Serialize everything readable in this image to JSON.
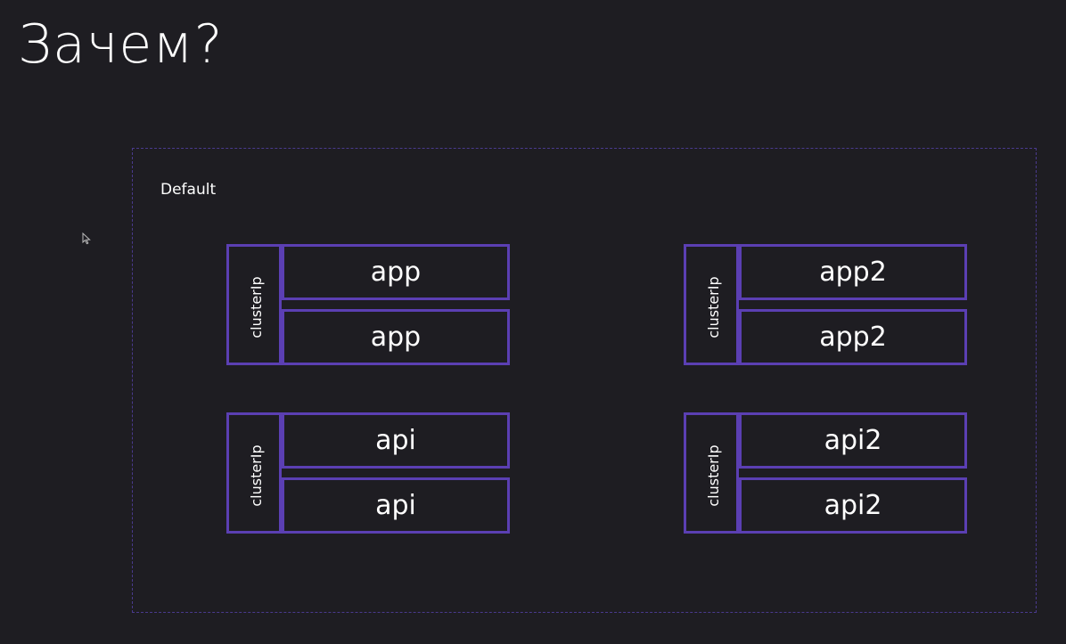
{
  "colors": {
    "background": "#1e1d22",
    "text": "#ffffff",
    "accent": "#5b3fb3",
    "namespace_border": "#4a3a8e",
    "cursor": "#bcbcbc"
  },
  "slide": {
    "title": "Зачем?"
  },
  "namespace": {
    "label": "Default"
  },
  "services": [
    {
      "label": "clusterIp",
      "pods": [
        "app",
        "app"
      ]
    },
    {
      "label": "clusterIp",
      "pods": [
        "app2",
        "app2"
      ]
    },
    {
      "label": "clusterIp",
      "pods": [
        "api",
        "api"
      ]
    },
    {
      "label": "clusterIp",
      "pods": [
        "api2",
        "api2"
      ]
    }
  ],
  "icons": {
    "cursor": "mouse-pointer-icon"
  }
}
